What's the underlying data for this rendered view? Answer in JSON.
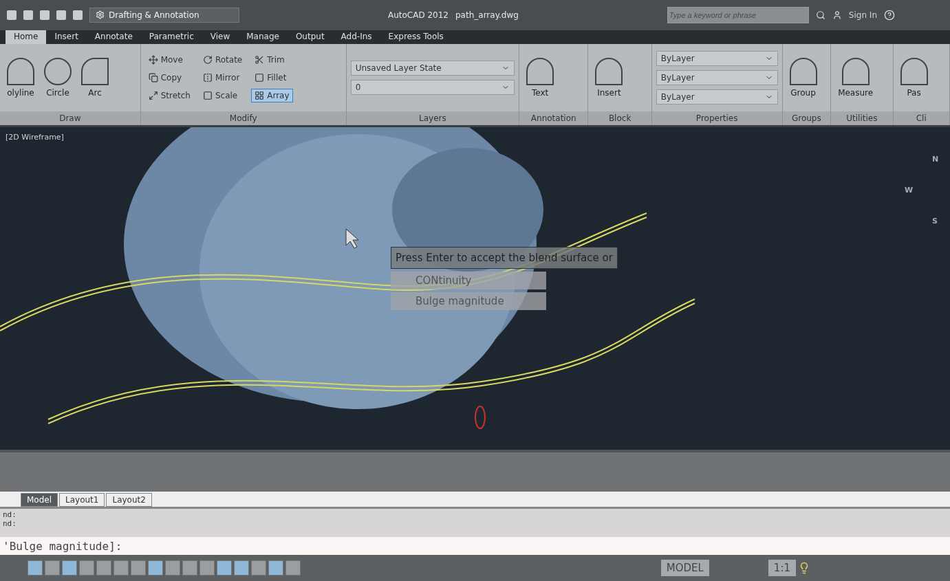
{
  "title_bar": {
    "workspace": "Drafting & Annotation",
    "app_title": "AutoCAD 2012",
    "file_name": "path_array.dwg",
    "search": {
      "placeholder": "Type a keyword or phrase"
    },
    "sign_in": "Sign In"
  },
  "ribbon_tabs": [
    {
      "label": "Home",
      "selected": true
    },
    {
      "label": "Insert",
      "selected": false
    },
    {
      "label": "Annotate",
      "selected": false
    },
    {
      "label": "Parametric",
      "selected": false
    },
    {
      "label": "View",
      "selected": false
    },
    {
      "label": "Manage",
      "selected": false
    },
    {
      "label": "Output",
      "selected": false
    },
    {
      "label": "Add-Ins",
      "selected": false
    },
    {
      "label": "Express Tools",
      "selected": false
    }
  ],
  "ribbon_panels": [
    {
      "kind": "large",
      "title": "Draw",
      "tools": [
        {
          "label": "olyline",
          "selected": false
        },
        {
          "label": "Circle",
          "selected": false
        },
        {
          "label": "Arc",
          "selected": false
        }
      ]
    },
    {
      "kind": "grid",
      "title": "Modify",
      "tools": [
        {
          "label": "Move",
          "selected": false
        },
        {
          "label": "Rotate",
          "selected": false
        },
        {
          "label": "Trim",
          "selected": false
        },
        {
          "label": "Copy",
          "selected": false
        },
        {
          "label": "Mirror",
          "selected": false
        },
        {
          "label": "Fillet",
          "selected": false
        },
        {
          "label": "Stretch",
          "selected": false
        },
        {
          "label": "Scale",
          "selected": false
        },
        {
          "label": "Array",
          "selected": true
        }
      ]
    },
    {
      "kind": "fields",
      "title": "Layers",
      "fields": [
        "Unsaved Layer State",
        "0"
      ]
    },
    {
      "kind": "large",
      "title": "Annotation",
      "tools": [
        {
          "label": "Text",
          "selected": false
        }
      ]
    },
    {
      "kind": "large",
      "title": "Block",
      "tools": [
        {
          "label": "Insert",
          "selected": false
        }
      ]
    },
    {
      "kind": "fields",
      "title": "Properties",
      "fields": [
        "ByLayer",
        "ByLayer",
        "ByLayer"
      ]
    },
    {
      "kind": "large",
      "title": "Groups",
      "tools": [
        {
          "label": "Group",
          "selected": false
        }
      ]
    },
    {
      "kind": "large",
      "title": "Utilities",
      "tools": [
        {
          "label": "Measure",
          "selected": false
        }
      ]
    },
    {
      "kind": "large",
      "title": "Cli",
      "tools": [
        {
          "label": "Pas",
          "selected": false
        }
      ]
    }
  ],
  "viewport": {
    "view_label": "[2D Wireframe]",
    "compass": [
      "N",
      "W",
      "S"
    ],
    "tooltip": {
      "prompt": "Press Enter to accept the blend surface or",
      "options": [
        "CONtinuity",
        "Bulge magnitude"
      ]
    }
  },
  "layout_tabs": [
    {
      "label": "Model",
      "selected": true
    },
    {
      "label": "Layout1",
      "selected": false
    },
    {
      "label": "Layout2",
      "selected": false
    }
  ],
  "command_line": {
    "history": [
      "nd:",
      "nd:"
    ],
    "prompt": "'Bulge magnitude]:"
  },
  "status_bar": {
    "toggles": [
      {
        "on": true
      },
      {
        "on": false
      },
      {
        "on": true
      },
      {
        "on": false
      },
      {
        "on": false
      },
      {
        "on": false
      },
      {
        "on": false
      },
      {
        "on": true
      },
      {
        "on": false
      },
      {
        "on": false
      },
      {
        "on": false
      },
      {
        "on": true
      },
      {
        "on": true
      },
      {
        "on": false
      },
      {
        "on": true
      },
      {
        "on": false
      }
    ],
    "space": "MODEL",
    "scale": "1:1"
  }
}
